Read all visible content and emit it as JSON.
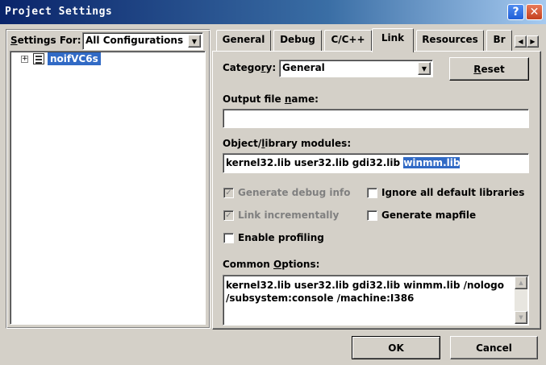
{
  "window": {
    "title": "Project Settings",
    "help_icon": "?",
    "close_icon": "✕"
  },
  "left": {
    "settings_for_label": "Settings For:",
    "configuration": "All Configurations",
    "tree": {
      "expander": "+",
      "project": "noifVC6s"
    }
  },
  "tabs": [
    "General",
    "Debug",
    "C/C++",
    "Link",
    "Resources",
    "Br"
  ],
  "active_tab": "Link",
  "link": {
    "category_label": "Category:",
    "category_value": "General",
    "reset_label": "Reset",
    "output_file_label": "Output file name:",
    "output_file_value": "",
    "modules_label": "Object/library modules:",
    "modules_value_plain": "kernel32.lib user32.lib gdi32.lib ",
    "modules_value_selected": "winmm.lib",
    "checkboxes": {
      "debug_info": {
        "label": "Generate debug info",
        "checked": true
      },
      "ignore_libs": {
        "label": "Ignore all default libraries",
        "checked": false
      },
      "link_incr": {
        "label": "Link incrementally",
        "checked": true
      },
      "mapfile": {
        "label": "Generate mapfile",
        "checked": false
      },
      "profiling": {
        "label": "Enable profiling",
        "checked": false
      }
    },
    "common_options_label": "Common Options:",
    "common_options_line1": "kernel32.lib user32.lib gdi32.lib winmm.lib /nologo",
    "common_options_line2": "/subsystem:console /machine:I386"
  },
  "buttons": {
    "ok": "OK",
    "cancel": "Cancel"
  }
}
